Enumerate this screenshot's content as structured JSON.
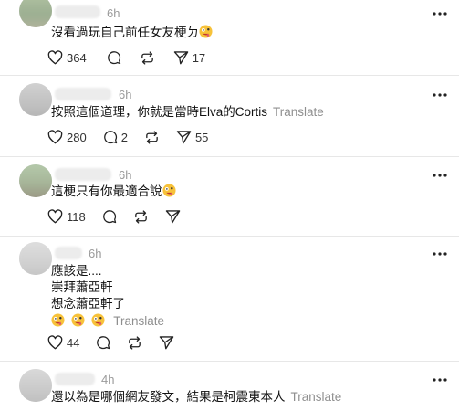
{
  "replies": [
    {
      "time": "6h",
      "lines": [
        "沒看過玩自己前任女友梗ㄉ"
      ],
      "emoji_count": 1,
      "translate": "",
      "likes": "364",
      "comments": "",
      "reposts": "",
      "shares": "17"
    },
    {
      "time": "6h",
      "lines": [
        "按照這個道理，你就是當時Elva的Cortis"
      ],
      "emoji_count": 0,
      "translate": "Translate",
      "likes": "280",
      "comments": "2",
      "reposts": "",
      "shares": "55"
    },
    {
      "time": "6h",
      "lines": [
        "這梗只有你最適合說"
      ],
      "emoji_count": 1,
      "translate": "",
      "likes": "118",
      "comments": "",
      "reposts": "",
      "shares": ""
    },
    {
      "time": "6h",
      "lines": [
        "應該是....",
        "崇拜蕭亞軒",
        "想念蕭亞軒了"
      ],
      "emoji_line_count": 3,
      "translate": "Translate",
      "likes": "44",
      "comments": "",
      "reposts": "",
      "shares": ""
    },
    {
      "time": "4h",
      "lines": [
        "還以為是哪個網友發文，結果是柯震東本人"
      ],
      "emoji_count": 0,
      "translate": "Translate"
    }
  ],
  "icons": {
    "like": "heart-icon",
    "comment": "comment-bubble-icon",
    "repost": "repost-icon",
    "share": "send-icon",
    "more": "more-horizontal-icon",
    "emoji": "crazy-face-emoji"
  }
}
